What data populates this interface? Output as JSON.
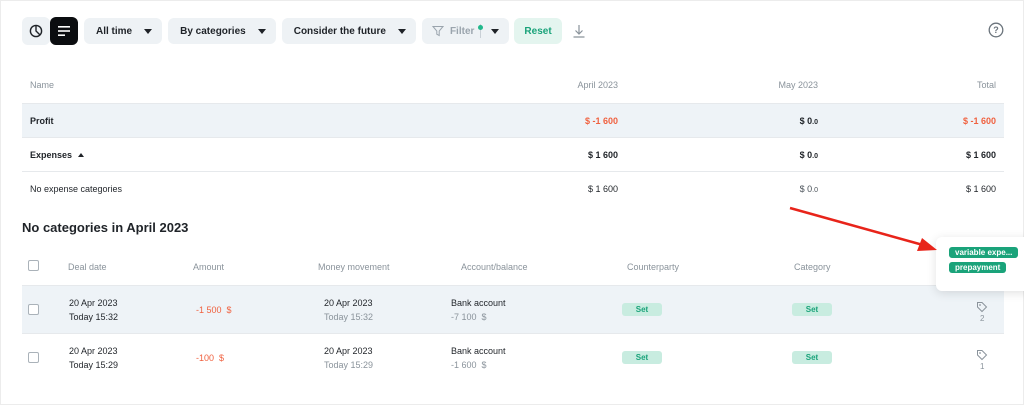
{
  "toolbar": {
    "period_label": "All time",
    "group_label": "By categories",
    "future_label": "Consider the future",
    "filter_label": "Filter",
    "reset_label": "Reset"
  },
  "summary": {
    "headers": {
      "name": "Name",
      "april": "April 2023",
      "may": "May 2023",
      "total": "Total"
    },
    "profit": {
      "name": "Profit",
      "april": "$ -1 600",
      "may_int": "$ 0",
      "may_dec": ".0",
      "total": "$ -1 600"
    },
    "expenses": {
      "name": "Expenses",
      "april": "$ 1 600",
      "may_int": "$ 0",
      "may_dec": ".0",
      "total": "$ 1 600"
    },
    "no_expense": {
      "name": "No expense categories",
      "april": "$ 1 600",
      "may_int": "$ 0",
      "may_dec": ".0",
      "total": "$ 1 600"
    }
  },
  "section_title": "No categories in April 2023",
  "transactions": {
    "headers": {
      "deal_date": "Deal date",
      "amount": "Amount",
      "money_movement": "Money movement",
      "account": "Account/balance",
      "counterparty": "Counterparty",
      "category": "Category"
    },
    "rows": [
      {
        "date": "20 Apr 2023",
        "time": "Today 15:32",
        "amount": "-1 500  $",
        "mm_date": "20 Apr 2023",
        "mm_time": "Today 15:32",
        "account": "Bank account",
        "balance": "-7 100  $",
        "counterparty": "Set",
        "category": "Set",
        "tag_count": "2"
      },
      {
        "date": "20 Apr 2023",
        "time": "Today 15:29",
        "amount": "-100  $",
        "mm_date": "20 Apr 2023",
        "mm_time": "Today 15:29",
        "account": "Bank account",
        "balance": "-1 600  $",
        "counterparty": "Set",
        "category": "Set",
        "tag_count": "1"
      }
    ]
  },
  "popover": {
    "tags": [
      "variable expe...",
      "prepayment"
    ]
  },
  "colors": {
    "accent": "#1aa37a",
    "negative": "#f0613f",
    "annotation_arrow": "#e8241a"
  },
  "icons": [
    "pie-chart-icon",
    "list-icon",
    "chevron-down-icon",
    "filter-icon",
    "download-icon",
    "help-icon",
    "tag-icon"
  ]
}
